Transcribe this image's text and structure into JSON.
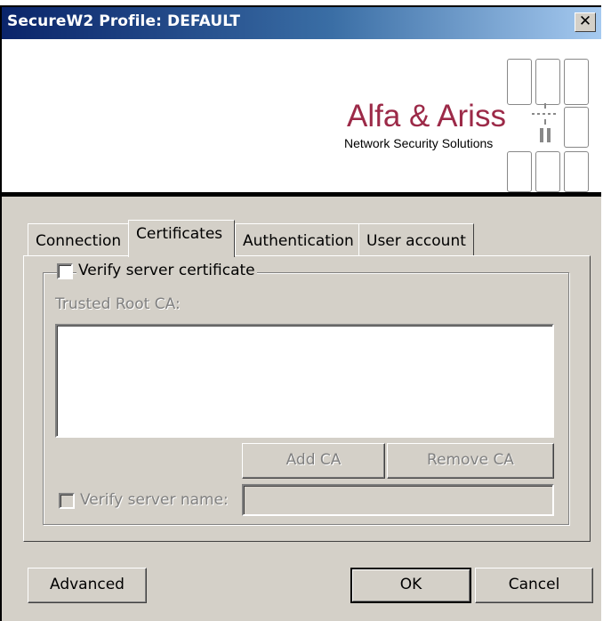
{
  "window": {
    "title": "SecureW2 Profile: DEFAULT",
    "close_glyph": "✕"
  },
  "banner": {
    "brand": "Alfa & Ariss",
    "tagline": "Network Security Solutions",
    "brand_color": "#9c2a48"
  },
  "tabs": [
    {
      "label": "Connection",
      "selected": false
    },
    {
      "label": "Certificates",
      "selected": true
    },
    {
      "label": "Authentication",
      "selected": false
    },
    {
      "label": "User account",
      "selected": false
    }
  ],
  "certificates": {
    "verify_server_certificate_label": "Verify server certificate",
    "verify_server_certificate_checked": false,
    "trusted_root_ca_label": "Trusted Root CA:",
    "trusted_root_ca_items": [],
    "add_ca_label": "Add CA",
    "remove_ca_label": "Remove CA",
    "verify_server_name_label": "Verify server name:",
    "verify_server_name_checked": false,
    "server_name_value": ""
  },
  "footer": {
    "advanced_label": "Advanced",
    "ok_label": "OK",
    "cancel_label": "Cancel"
  }
}
